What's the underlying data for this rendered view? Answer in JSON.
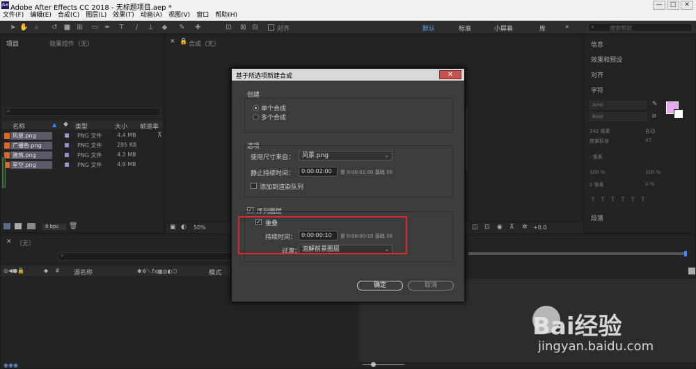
{
  "window": {
    "title": "Adobe After Effects CC 2018 - 无标题项目.aep *",
    "app_icon": "Ae",
    "controls": [
      "—",
      "□",
      "✕"
    ]
  },
  "menu": [
    "文件(F)",
    "编辑(E)",
    "合成(C)",
    "图层(L)",
    "效果(T)",
    "动画(A)",
    "视图(V)",
    "窗口",
    "帮助(H)"
  ],
  "toolbar": {
    "align_label": "对齐",
    "workspaces": [
      "默认",
      "标准",
      "小屏幕",
      "库"
    ],
    "active_workspace": "默认",
    "more": "»",
    "search_placeholder": "搜索帮助"
  },
  "project": {
    "tab": "项目",
    "effects_tab": "效果控件（无）",
    "cols": [
      "名称",
      "类型",
      "大小",
      "帧速率"
    ],
    "files": [
      {
        "name": "风景.png",
        "type": "PNG 文件",
        "size": "4.4 MB"
      },
      {
        "name": "广播色.png",
        "type": "PNG 文件",
        "size": "285 KB"
      },
      {
        "name": "建筑.png",
        "type": "PNG 文件",
        "size": "4.2 MB"
      },
      {
        "name": "星空.png",
        "type": "PNG 文件",
        "size": "4.9 MB"
      }
    ],
    "bpc": "8 bpc"
  },
  "composition": {
    "tab": "合成（无）",
    "zoom": "50%",
    "offset": "+0.0"
  },
  "right_panel": {
    "items": [
      "信息",
      "效果和预设",
      "对齐",
      "字符"
    ],
    "font": "Arial",
    "style": "Bold",
    "size": "242 像素",
    "leading": "自动",
    "tracking": "度量标准",
    "tracking_val": "47",
    "unit": "- 像素",
    "scale_v": "100 %",
    "scale_h": "100 %",
    "baseline": "0 像素",
    "tsume": "0 %",
    "paragraph": "段落",
    "fill_color": "#e7a8ee"
  },
  "timeline": {
    "tab": "（无）",
    "col_name": "源名称",
    "col_mode": "模式"
  },
  "dialog": {
    "title": "基于所选项新建合成",
    "create": {
      "label": "创建",
      "single": "单个合成",
      "multi": "多个合成"
    },
    "options": {
      "label": "选项",
      "use_size_label": "使用尺寸来自：",
      "use_size_value": "风景.png",
      "still_label": "静止持续时间：",
      "still_value": "0:00:02:00",
      "still_note": "是 0:00:02:00 基础 30",
      "add_render": "添加到渲染队列"
    },
    "sequence": {
      "label": "序列图层",
      "overlap": "重叠",
      "dur_label": "持续时间：",
      "dur_value": "0:00:00:10",
      "dur_note": "是 0:00:00:10 基础 30",
      "trans_label": "过渡：",
      "trans_value": "溶解前景图层"
    },
    "ok": "确定",
    "cancel": "取消"
  },
  "watermark": {
    "brand": "Bai经验",
    "url": "jingyan.baidu.com"
  }
}
